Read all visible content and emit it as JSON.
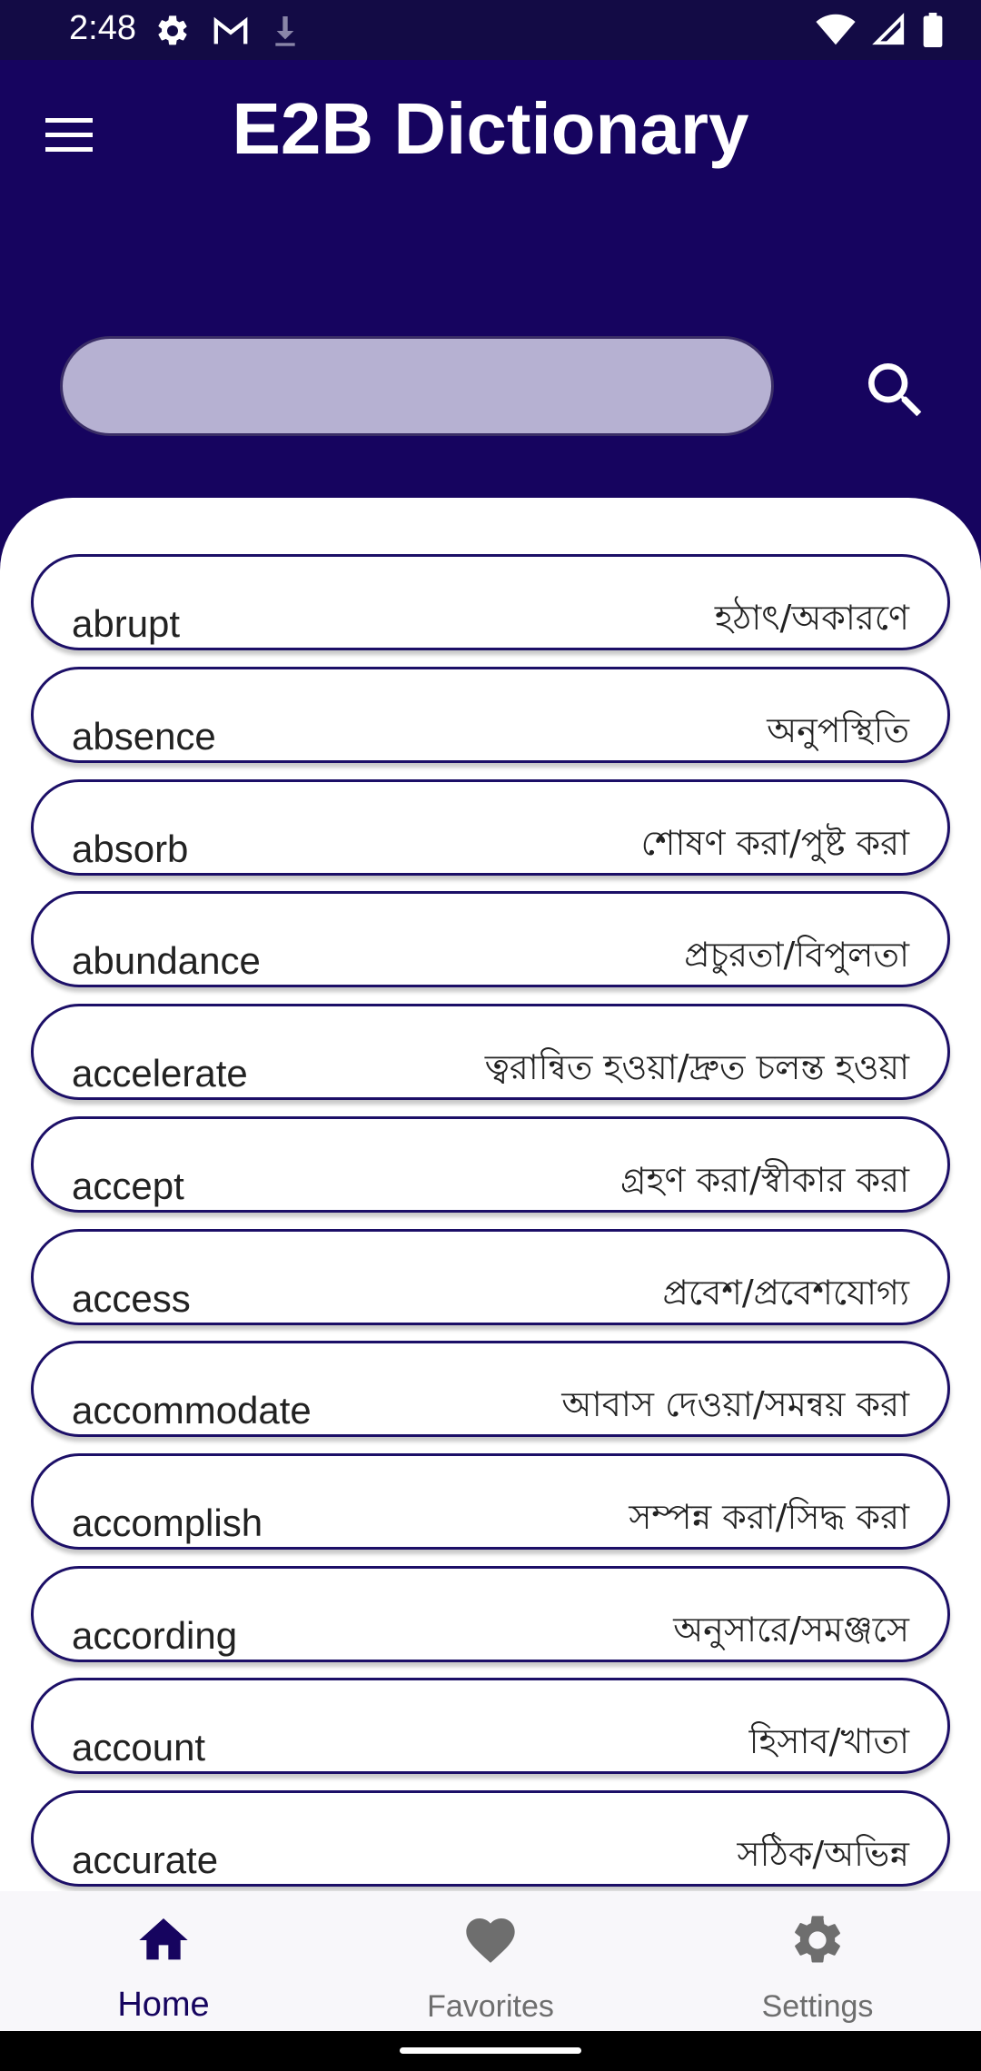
{
  "status_bar": {
    "time": "2:48",
    "icons_left": [
      "settings-icon",
      "gmail-icon",
      "download-icon"
    ],
    "icons_right": [
      "wifi-icon",
      "signal-icon",
      "battery-icon"
    ]
  },
  "app_bar": {
    "title": "E2B Dictionary",
    "menu_icon": "hamburger-menu-icon"
  },
  "search": {
    "value": "",
    "placeholder": "",
    "icon": "search-icon"
  },
  "words": [
    {
      "en": "abrupt",
      "bn": "হঠাৎ/অকারণে"
    },
    {
      "en": "absence",
      "bn": "অনুপস্থিতি"
    },
    {
      "en": "absorb",
      "bn": "শোষণ করা/পুষ্ট করা"
    },
    {
      "en": "abundance",
      "bn": "প্রচুরতা/বিপুলতা"
    },
    {
      "en": "accelerate",
      "bn": "ত্বরান্বিত হওয়া/দ্রুত চলন্ত হওয়া"
    },
    {
      "en": "accept",
      "bn": "গ্রহণ করা/স্বীকার করা"
    },
    {
      "en": "access",
      "bn": "প্রবেশ/প্রবেশযোগ্য"
    },
    {
      "en": "accommodate",
      "bn": "আবাস দেওয়া/সমন্বয় করা"
    },
    {
      "en": "accomplish",
      "bn": "সম্পন্ন করা/সিদ্ধ করা"
    },
    {
      "en": "according",
      "bn": "অনুসারে/সমঞ্জসে"
    },
    {
      "en": "account",
      "bn": "হিসাব/খাতা"
    },
    {
      "en": "accurate",
      "bn": "সঠিক/অভিন্ন"
    }
  ],
  "bottom_nav": {
    "items": [
      {
        "label": "Home",
        "icon": "home-icon",
        "active": true
      },
      {
        "label": "Favorites",
        "icon": "heart-icon",
        "active": false
      },
      {
        "label": "Settings",
        "icon": "gear-icon",
        "active": false
      }
    ]
  },
  "colors": {
    "primary": "#16045f",
    "search_fill": "#b6b1d2",
    "card_border": "#1c0f67",
    "nav_inactive": "#6e6e6e"
  }
}
